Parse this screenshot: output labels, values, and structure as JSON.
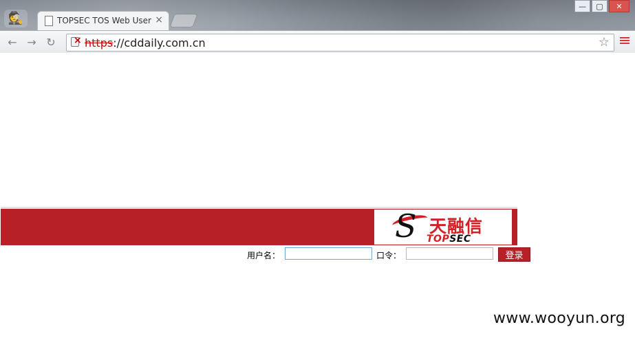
{
  "browser": {
    "tab": {
      "title": "TOPSEC TOS Web User",
      "close": "×"
    },
    "address": {
      "scheme": "https",
      "separator": "://",
      "host": "cddaily.com.cn"
    },
    "icons": {
      "incognito": "incognito-icon",
      "back": "back-arrow-icon",
      "forward": "forward-arrow-icon",
      "reload": "reload-icon",
      "lock_error": "lock-error-icon",
      "star": "star-icon",
      "menu": "menu-icon",
      "minimize": "minimize-icon",
      "maximize": "maximize-icon",
      "close": "close-icon"
    }
  },
  "brand": {
    "logo_cn": "天融信",
    "logo_en_red": "TOP",
    "logo_en_black": "SEC"
  },
  "login": {
    "username_label": "用户名：",
    "password_label": "口令：",
    "submit_label": "登录",
    "username_value": "",
    "password_value": ""
  },
  "watermark": "www.wooyun.org",
  "colors": {
    "brand_red": "#b72026",
    "link_red": "#c00"
  }
}
